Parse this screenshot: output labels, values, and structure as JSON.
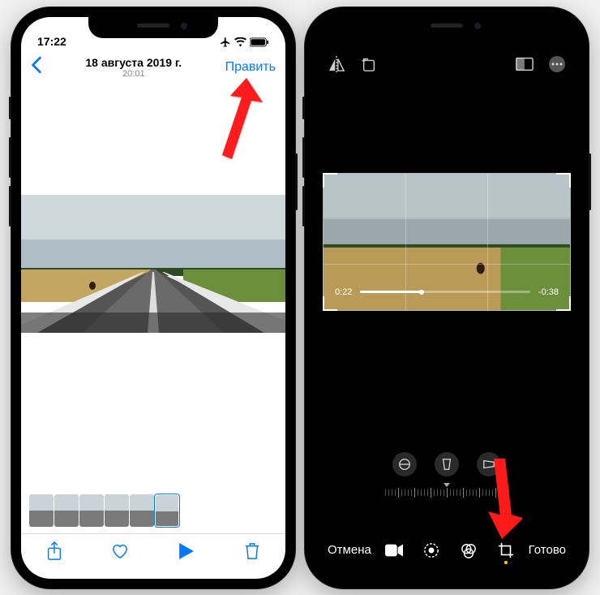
{
  "left": {
    "status": {
      "time": "17:22"
    },
    "header": {
      "date": "18 августа 2019 г.",
      "time": "20:01",
      "edit": "Править"
    }
  },
  "right": {
    "playback": {
      "elapsed": "0:22",
      "remaining": "-0:38"
    },
    "footer": {
      "cancel": "Отмена",
      "done": "Готово"
    }
  }
}
